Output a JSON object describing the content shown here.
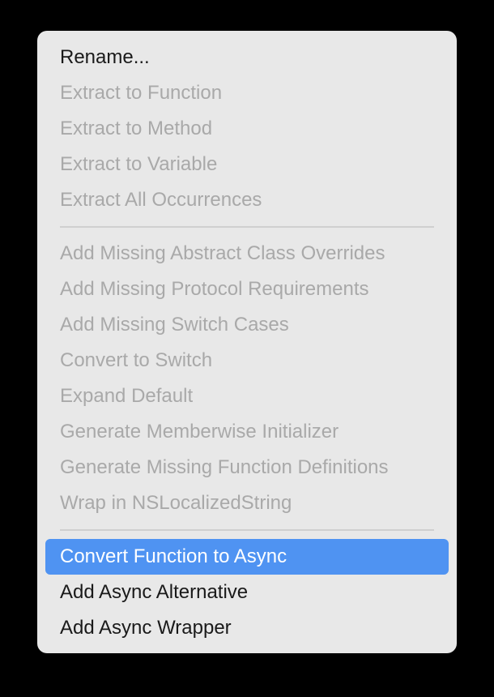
{
  "menu": {
    "groups": [
      {
        "items": [
          {
            "label": "Rename...",
            "enabled": true
          },
          {
            "label": "Extract to Function",
            "enabled": false
          },
          {
            "label": "Extract to Method",
            "enabled": false
          },
          {
            "label": "Extract to Variable",
            "enabled": false
          },
          {
            "label": "Extract All Occurrences",
            "enabled": false
          }
        ]
      },
      {
        "items": [
          {
            "label": "Add Missing Abstract Class Overrides",
            "enabled": false
          },
          {
            "label": "Add Missing Protocol Requirements",
            "enabled": false
          },
          {
            "label": "Add Missing Switch Cases",
            "enabled": false
          },
          {
            "label": "Convert to Switch",
            "enabled": false
          },
          {
            "label": "Expand Default",
            "enabled": false
          },
          {
            "label": "Generate Memberwise Initializer",
            "enabled": false
          },
          {
            "label": "Generate Missing Function Definitions",
            "enabled": false
          },
          {
            "label": "Wrap in NSLocalizedString",
            "enabled": false
          }
        ]
      },
      {
        "items": [
          {
            "label": "Convert Function to Async",
            "enabled": true,
            "selected": true
          },
          {
            "label": "Add Async Alternative",
            "enabled": true
          },
          {
            "label": "Add Async Wrapper",
            "enabled": true
          }
        ]
      }
    ],
    "colors": {
      "highlight": "#4f93f2",
      "disabled_text": "#a9a9a9",
      "menu_background": "#e8e8e8"
    }
  }
}
